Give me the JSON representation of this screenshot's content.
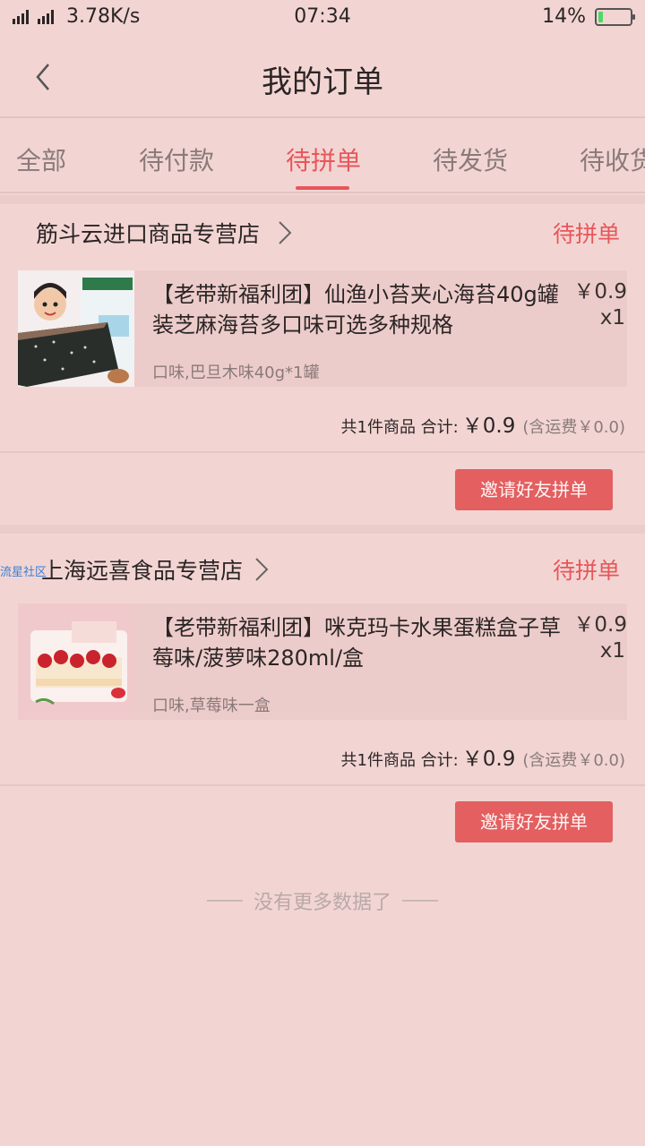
{
  "status_bar": {
    "speed": "3.78K/s",
    "time": "07:34",
    "battery_percent": "14%",
    "battery_level": 0.14
  },
  "header": {
    "title": "我的订单"
  },
  "tabs": [
    {
      "label": "全部"
    },
    {
      "label": "待付款"
    },
    {
      "label": "待拼单",
      "active": true
    },
    {
      "label": "待发货"
    },
    {
      "label": "待收货"
    }
  ],
  "orders": [
    {
      "shop_name": "筋斗云进口商品专营店",
      "status": "待拼单",
      "product_title": "【老带新福利团】仙渔小苔夹心海苔40g罐装芝麻海苔多口味可选多种规格",
      "spec": "口味,巴旦木味40g*1罐",
      "price": "￥0.9",
      "qty": "x1",
      "total_prefix": "共1件商品 合计:",
      "total_amount": "￥0.9",
      "shipping": "(含运费￥0.0)",
      "button_label": "邀请好友拼单"
    },
    {
      "shop_name": "上海远喜食品专营店",
      "watermark": "流星社区",
      "status": "待拼单",
      "product_title": "【老带新福利团】咪克玛卡水果蛋糕盒子草莓味/菠萝味280ml/盒",
      "spec": "口味,草莓味一盒",
      "price": "￥0.9",
      "qty": "x1",
      "total_prefix": "共1件商品 合计:",
      "total_amount": "￥0.9",
      "shipping": "(含运费￥0.0)",
      "button_label": "邀请好友拼单"
    }
  ],
  "footer": {
    "no_more": "没有更多数据了"
  },
  "colors": {
    "accent": "#e8565a",
    "background": "#f2d5d3",
    "button": "#e35f60"
  }
}
